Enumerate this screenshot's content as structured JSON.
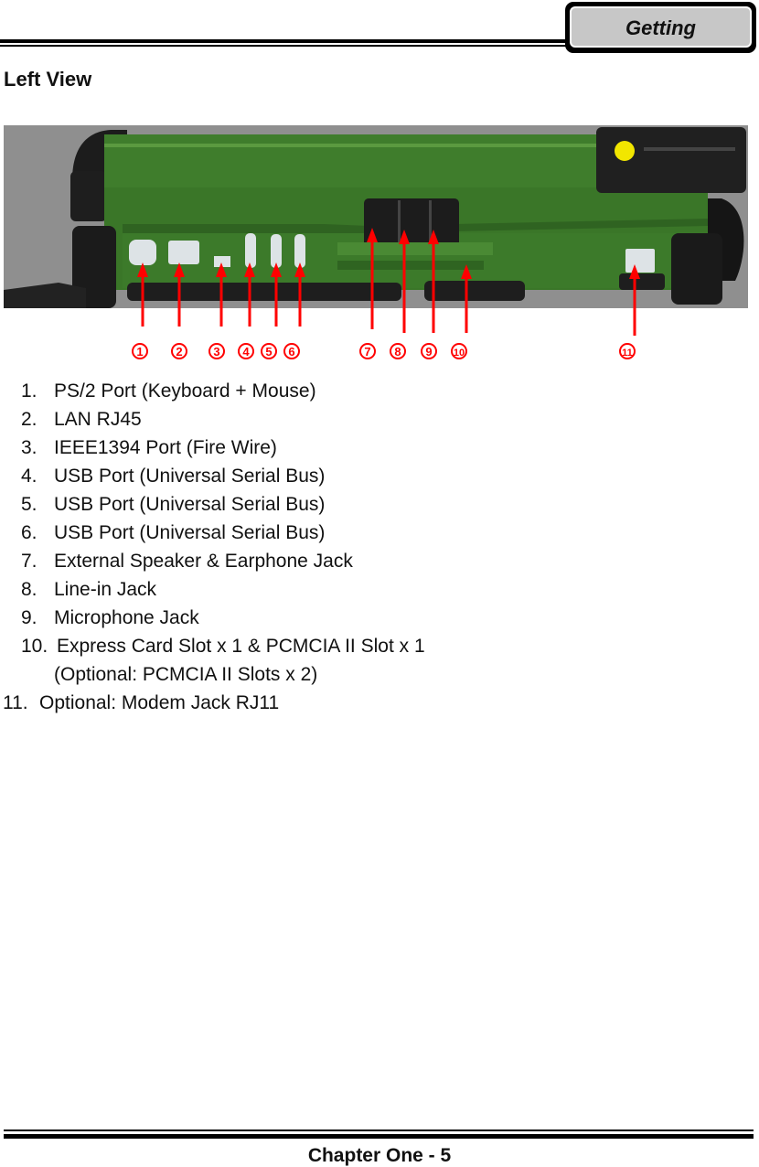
{
  "header": {
    "chapter_tab": "Getting"
  },
  "section": {
    "title": "Left View"
  },
  "figure": {
    "description": "Left side view of rugged notebook with numbered port callouts",
    "callout_color": "#ff0000",
    "body_color": "#3e7a2a",
    "callouts": [
      "1",
      "2",
      "3",
      "4",
      "5",
      "6",
      "7",
      "8",
      "9",
      "10",
      "11"
    ]
  },
  "items": [
    {
      "num": "1.",
      "text": "PS/2 Port (Keyboard + Mouse)"
    },
    {
      "num": "2.",
      "text": "LAN RJ45"
    },
    {
      "num": "3.",
      "text": "IEEE1394 Port (Fire Wire)"
    },
    {
      "num": "4.",
      "text": "USB Port (Universal Serial Bus)"
    },
    {
      "num": "5.",
      "text": "USB Port (Universal Serial Bus)"
    },
    {
      "num": "6.",
      "text": "USB Port (Universal Serial Bus)"
    },
    {
      "num": "7.",
      "text": "External Speaker & Earphone Jack"
    },
    {
      "num": "8.",
      "text": "Line-in Jack"
    },
    {
      "num": "9.",
      "text": "Microphone Jack"
    },
    {
      "num": "10.",
      "text": "Express Card Slot x 1 & PCMCIA II Slot x 1"
    },
    {
      "num": "",
      "text": "(Optional: PCMCIA II Slots x 2)"
    },
    {
      "num": "11.",
      "text": "Optional: Modem Jack RJ11"
    }
  ],
  "footer": {
    "page_label": "Chapter One - 5"
  }
}
